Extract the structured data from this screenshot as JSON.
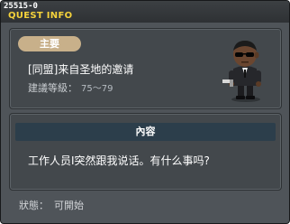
{
  "window": {
    "quest_id": "25515-0",
    "title": "QUEST INFO"
  },
  "quest": {
    "badge_label": "主要",
    "name": "[同盟]来自圣地的邀请",
    "level_label": "建議等級：",
    "level_value": "75～79",
    "npc_icon": "npc-agent-in-suit-with-sunglasses"
  },
  "content": {
    "header": "內容",
    "dialogue": "工作人员I突然跟我说话。有什么事吗?"
  },
  "status": {
    "label": "狀態：",
    "value": "可開始"
  }
}
